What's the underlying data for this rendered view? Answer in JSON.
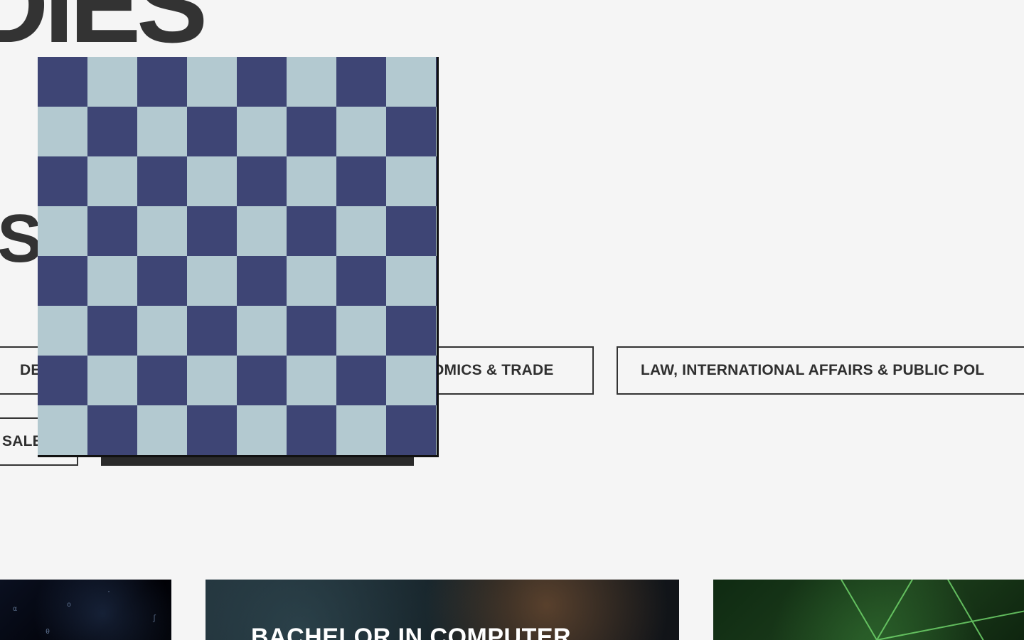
{
  "heading": {
    "top_fragment": "DIES",
    "mid_fragment": "S"
  },
  "filters": {
    "design": "DE",
    "economics": "OMICS & TRADE",
    "law": "LAW, INTERNATIONAL AFFAIRS & PUBLIC POL",
    "sales": "SALE"
  },
  "cards": {
    "computer_science_title": "BACHELOR IN COMPUTER"
  },
  "colors": {
    "checker_light": "#b3c9d0",
    "checker_dark": "#3e4575",
    "text_dark": "#333333",
    "background": "#f5f5f5"
  }
}
